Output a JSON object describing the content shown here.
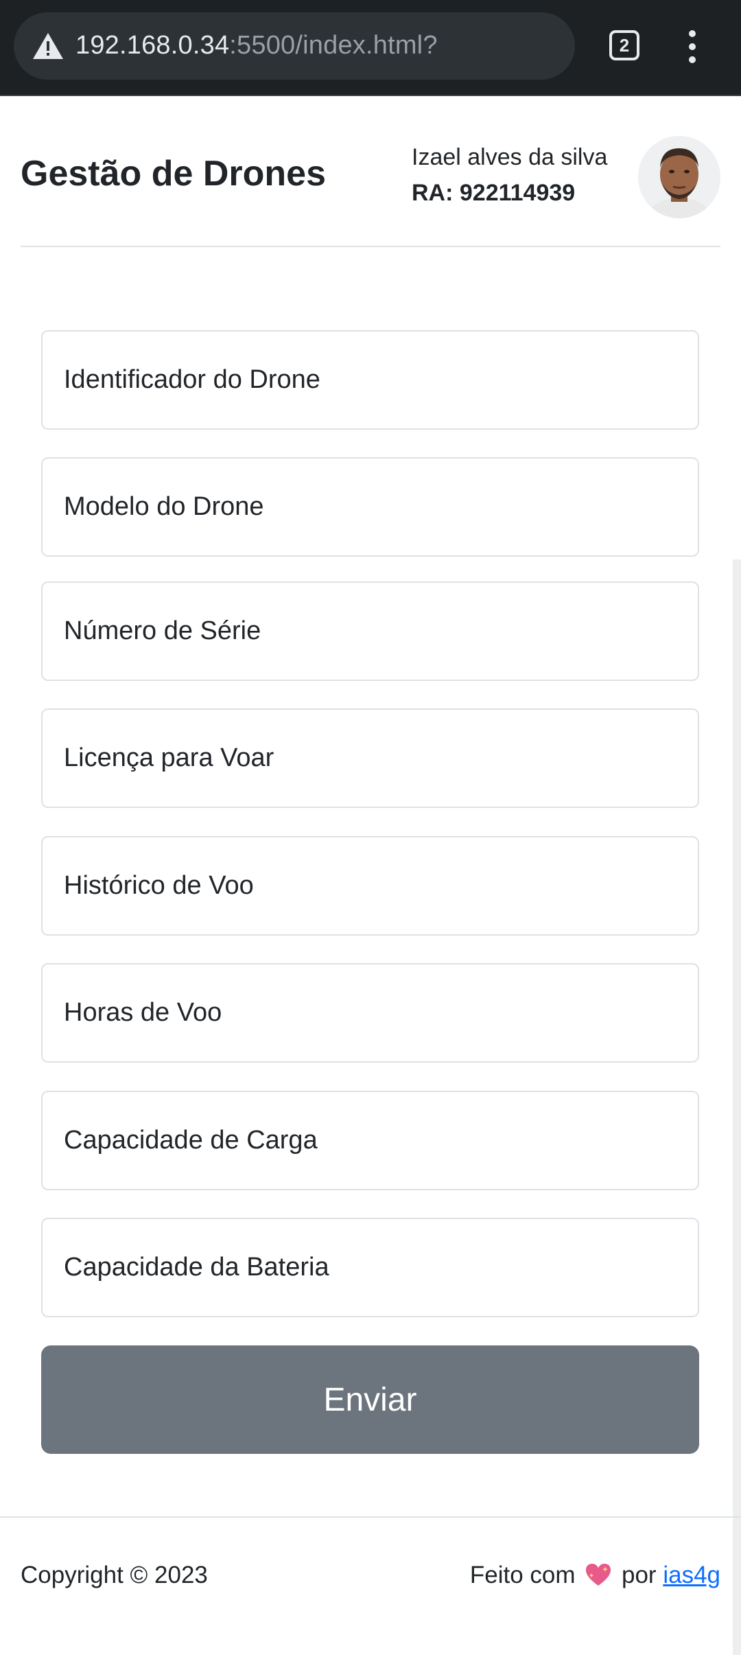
{
  "browser": {
    "url_host": "192.168.0.34",
    "url_rest": ":5500/index.html?",
    "tab_count": "2",
    "icons": [
      "warning-icon",
      "tab-switcher-icon",
      "more-vert-icon"
    ]
  },
  "header": {
    "title": "Gestão de Drones",
    "user_name": "Izael alves da silva",
    "user_ra": "RA: 922114939"
  },
  "form": {
    "fields": [
      {
        "placeholder": "Identificador do Drone"
      },
      {
        "placeholder": "Modelo do Drone"
      },
      {
        "placeholder": "Número de Série"
      },
      {
        "placeholder": "Licença para Voar"
      },
      {
        "placeholder": "Histórico de Voo"
      },
      {
        "placeholder": "Horas de Voo"
      },
      {
        "placeholder": "Capacidade de Carga"
      },
      {
        "placeholder": "Capacidade da Bateria"
      }
    ],
    "submit_label": "Enviar"
  },
  "footer": {
    "copyright": "Copyright © 2023",
    "made_with_prefix": "Feito com",
    "made_with_middle": "por",
    "author_link": "ias4g"
  },
  "colors": {
    "submit_bg": "#6c757d",
    "link": "#0d6efd",
    "heart": "#e75a8a",
    "chrome_bg": "#1e2124"
  }
}
